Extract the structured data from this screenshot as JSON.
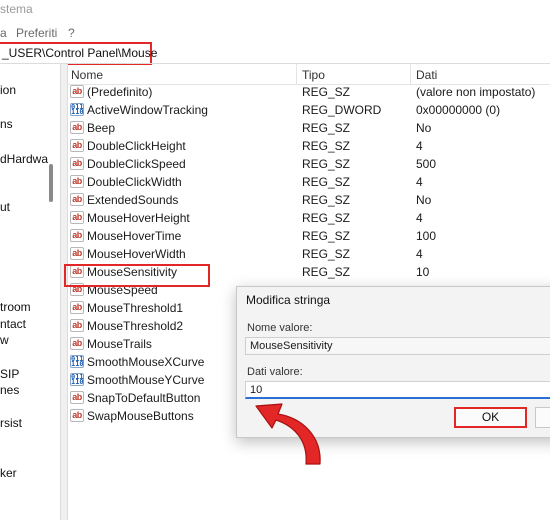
{
  "window": {
    "title": "stema"
  },
  "menu": {
    "items": [
      "a",
      "Preferiti",
      "?"
    ]
  },
  "address": {
    "path": "_USER\\Control Panel\\Mouse"
  },
  "tree": {
    "items": [
      "ion",
      "ns",
      "dHardwa",
      "ut",
      "troom",
      "ntact",
      "w",
      "SIP",
      "nes",
      "rsist",
      "ker"
    ]
  },
  "columns": {
    "name": "Nome",
    "type": "Tipo",
    "data": "Dati"
  },
  "rows": [
    {
      "icon": "string-value-icon",
      "name": "(Predefinito)",
      "type": "REG_SZ",
      "data": "(valore non impostato)"
    },
    {
      "icon": "binary-value-icon",
      "name": "ActiveWindowTracking",
      "type": "REG_DWORD",
      "data": "0x00000000 (0)"
    },
    {
      "icon": "string-value-icon",
      "name": "Beep",
      "type": "REG_SZ",
      "data": "No"
    },
    {
      "icon": "string-value-icon",
      "name": "DoubleClickHeight",
      "type": "REG_SZ",
      "data": "4"
    },
    {
      "icon": "string-value-icon",
      "name": "DoubleClickSpeed",
      "type": "REG_SZ",
      "data": "500"
    },
    {
      "icon": "string-value-icon",
      "name": "DoubleClickWidth",
      "type": "REG_SZ",
      "data": "4"
    },
    {
      "icon": "string-value-icon",
      "name": "ExtendedSounds",
      "type": "REG_SZ",
      "data": "No"
    },
    {
      "icon": "string-value-icon",
      "name": "MouseHoverHeight",
      "type": "REG_SZ",
      "data": "4"
    },
    {
      "icon": "string-value-icon",
      "name": "MouseHoverTime",
      "type": "REG_SZ",
      "data": "100"
    },
    {
      "icon": "string-value-icon",
      "name": "MouseHoverWidth",
      "type": "REG_SZ",
      "data": "4"
    },
    {
      "icon": "string-value-icon",
      "name": "MouseSensitivity",
      "type": "REG_SZ",
      "data": "10"
    },
    {
      "icon": "string-value-icon",
      "name": "MouseSpeed",
      "type": "",
      "data": ""
    },
    {
      "icon": "string-value-icon",
      "name": "MouseThreshold1",
      "type": "",
      "data": ""
    },
    {
      "icon": "string-value-icon",
      "name": "MouseThreshold2",
      "type": "",
      "data": ""
    },
    {
      "icon": "string-value-icon",
      "name": "MouseTrails",
      "type": "",
      "data": ""
    },
    {
      "icon": "binary-value-icon",
      "name": "SmoothMouseXCurve",
      "type": "",
      "data": ""
    },
    {
      "icon": "binary-value-icon",
      "name": "SmoothMouseYCurve",
      "type": "",
      "data": ""
    },
    {
      "icon": "string-value-icon",
      "name": "SnapToDefaultButton",
      "type": "",
      "data": ""
    },
    {
      "icon": "string-value-icon",
      "name": "SwapMouseButtons",
      "type": "",
      "data": ""
    }
  ],
  "dialog": {
    "title": "Modifica stringa",
    "name_label": "Nome valore:",
    "name_value": "MouseSensitivity",
    "data_label": "Dati valore:",
    "data_value": "10",
    "ok_label": "OK",
    "cancel_label": ""
  },
  "colors": {
    "highlight": "#e32626",
    "focus": "#2a6fd6"
  },
  "icons": {
    "string_glyph": "ab",
    "binary_glyph": "011 110"
  }
}
